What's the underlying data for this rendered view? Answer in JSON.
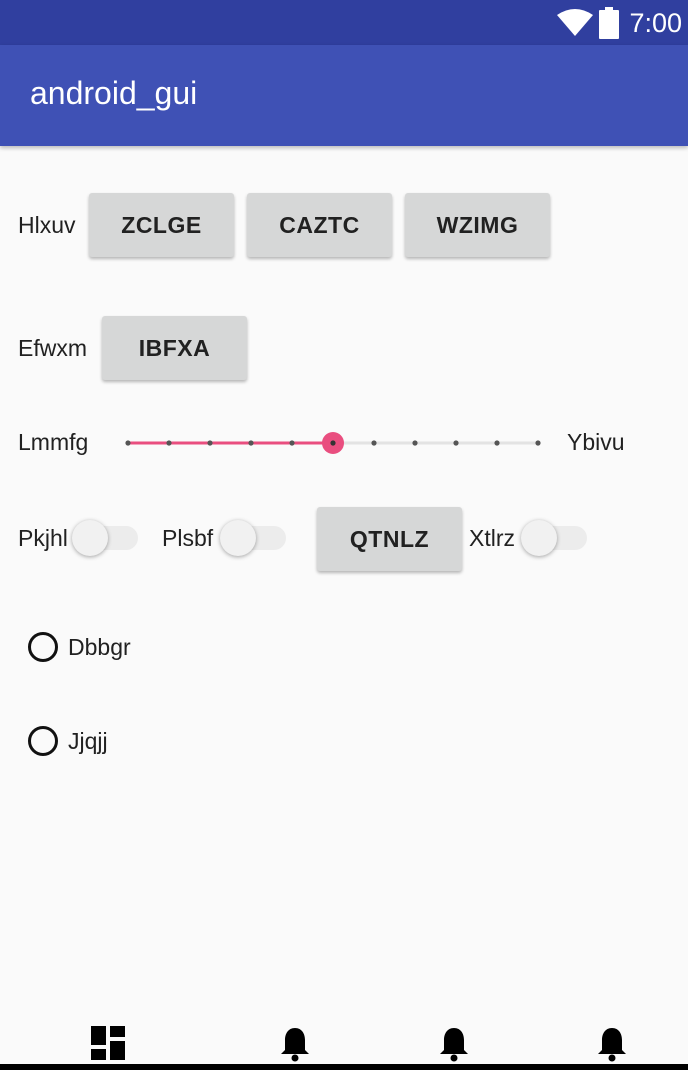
{
  "status_bar": {
    "time": "7:00",
    "icons": [
      "wifi-icon",
      "battery-icon"
    ]
  },
  "app_bar": {
    "title": "android_gui"
  },
  "row1": {
    "label": "Hlxuv",
    "buttons": [
      "ZCLGE",
      "CAZTC",
      "WZIMG"
    ]
  },
  "row2": {
    "label": "Efwxm",
    "button": "IBFXA"
  },
  "slider": {
    "label_left": "Lmmfg",
    "label_right": "Ybivu",
    "value": 5,
    "max": 10,
    "accent": "#e94e7f"
  },
  "row4": {
    "switch1_label": "Pkjhl",
    "switch1_on": false,
    "switch2_label": "Plsbf",
    "switch2_on": false,
    "button": "QTNLZ",
    "switch3_label": "Xtlrz",
    "switch3_on": false
  },
  "radios": [
    {
      "label": "Dbbgr",
      "checked": false
    },
    {
      "label": "Jjqjj",
      "checked": false
    }
  ],
  "bottom_nav": {
    "icons": [
      "dashboard-icon",
      "notifications-icon",
      "notifications-icon",
      "notifications-icon"
    ]
  },
  "colors": {
    "status_bar": "#303f9f",
    "app_bar": "#3f51b5",
    "background": "#fafafa",
    "button": "#d6d7d7"
  }
}
